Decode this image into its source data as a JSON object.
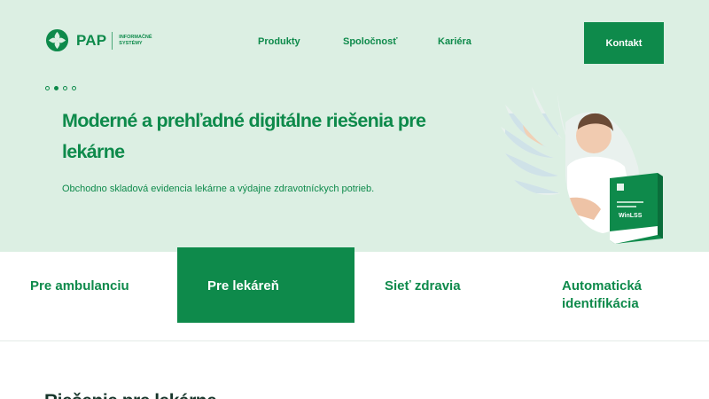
{
  "brand": {
    "name": "PAP",
    "subtitle_line1": "INFORMAČNÉ",
    "subtitle_line2": "SYSTÉMY",
    "color": "#0e8a4b"
  },
  "nav": {
    "items": [
      {
        "label": "Produkty"
      },
      {
        "label": "Spoločnosť"
      },
      {
        "label": "Kariéra"
      }
    ],
    "cta_label": "Kontakt"
  },
  "hero": {
    "title": "Moderné a prehľadné digitálne riešenia pre lekárne",
    "subtitle": "Obchodno skladová evidencia lekárne a výdajne zdravotníckych potrieb.",
    "slide_count": 4,
    "active_slide": 2,
    "background": "#dcefe3",
    "product_box_label": "WinLSS"
  },
  "tabs": {
    "items": [
      {
        "label": "Pre ambulanciu",
        "active": false
      },
      {
        "label": "Pre lekáreň",
        "active": true
      },
      {
        "label": "Sieť zdravia",
        "active": false
      },
      {
        "label": "Automatická identifikácia",
        "active": false
      }
    ]
  },
  "section": {
    "heading": "Riešenie pre lekárne"
  },
  "icons": [
    "pap-logo-icon",
    "pharmacist-photo",
    "winlss-product-box"
  ]
}
